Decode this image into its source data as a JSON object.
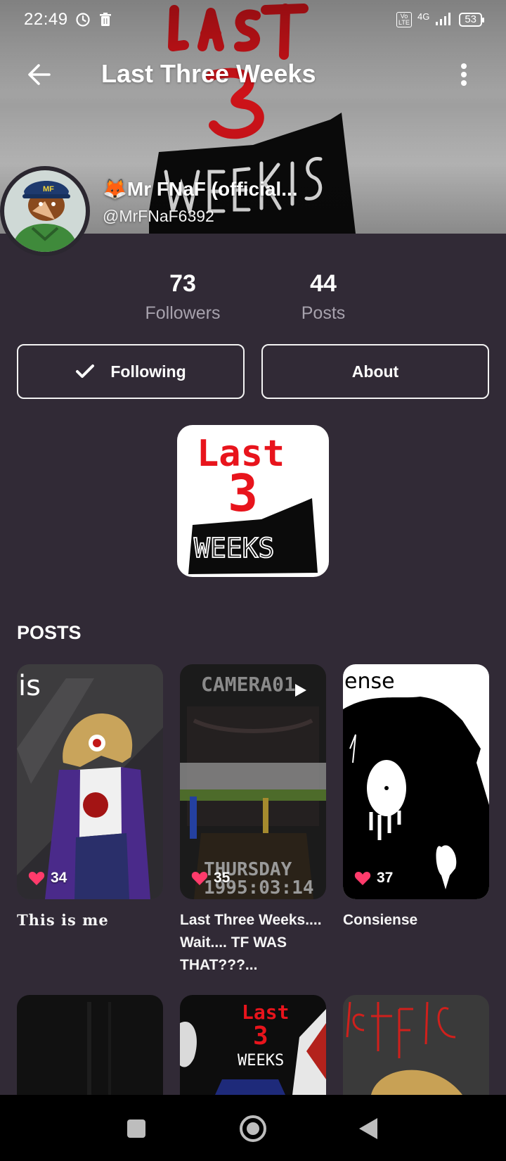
{
  "status_bar": {
    "time": "22:49",
    "network": "4G",
    "volte": "Vo LTE",
    "battery": "53"
  },
  "app_bar": {
    "title": "Last Three Weeks"
  },
  "profile": {
    "display_name": "🦊Mr FNaF (official...",
    "handle": "@MrFNaF6392"
  },
  "stats": [
    {
      "value": "73",
      "label": "Followers"
    },
    {
      "value": "44",
      "label": "Posts"
    }
  ],
  "actions": {
    "following_label": "Following",
    "about_label": "About"
  },
  "community_logo_text": {
    "line1": "Last",
    "line2": "3",
    "line3": "WEEKS"
  },
  "posts_section": {
    "title": "POSTS",
    "items": [
      {
        "likes": "34",
        "caption": "This is me"
      },
      {
        "likes": "35",
        "caption": "Last Three Weeks.... Wait.... TF WAS THAT???..."
      },
      {
        "likes": "37",
        "caption": "Consiense"
      }
    ]
  },
  "post_art_text": {
    "p1_corner": "is",
    "p2_top": "CAMERA01",
    "p2_day": "THURSDAY",
    "p2_date": "1995:03:14",
    "p3_corner": "ense"
  },
  "colors": {
    "background": "#312a36",
    "like_heart": "#ff3b6b",
    "logo_red": "#e8141c"
  },
  "icons": {
    "back": "arrow-left-icon",
    "more": "more-vertical-icon",
    "check": "check-icon",
    "heart": "heart-icon",
    "play": "play-icon"
  }
}
